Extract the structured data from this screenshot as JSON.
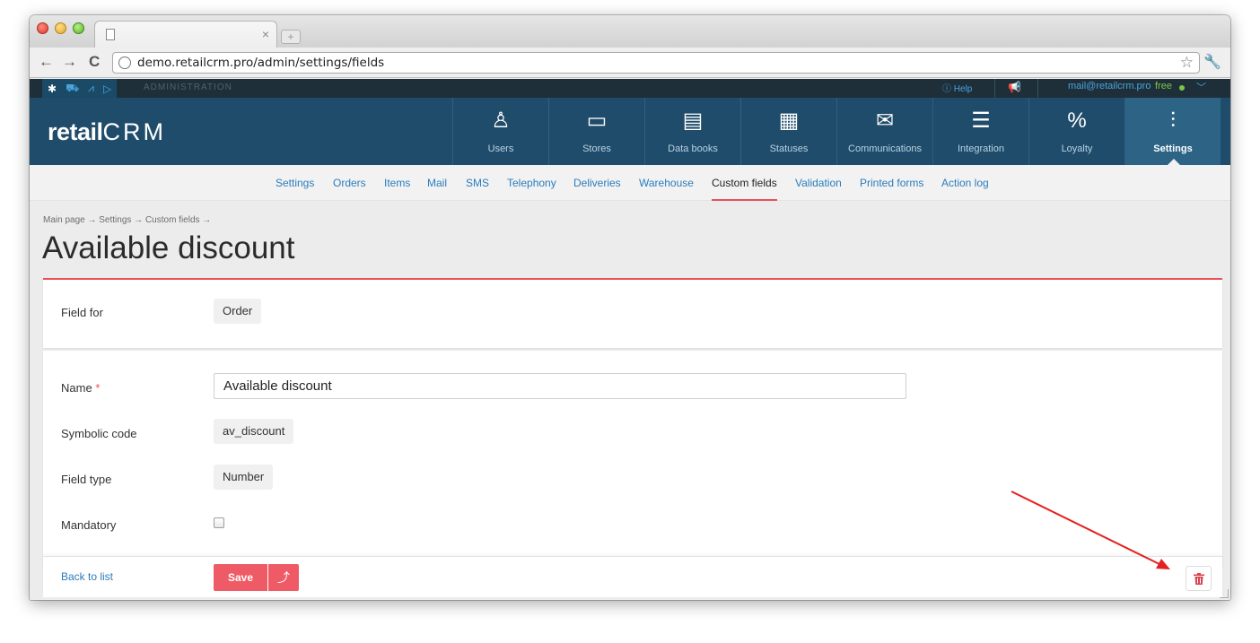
{
  "browser": {
    "url": "demo.retailcrm.pro/admin/settings/fields",
    "tab_close": "×"
  },
  "adminbar": {
    "label": "ADMINISTRATION",
    "help": "Help",
    "email": "mail@retailcrm.pro",
    "plan": "free"
  },
  "header": {
    "logo_text": "retail",
    "logo_crm": "CRM",
    "nav": [
      {
        "label": "Users",
        "icon": "user-icon"
      },
      {
        "label": "Stores",
        "icon": "store-icon"
      },
      {
        "label": "Data books",
        "icon": "book-icon"
      },
      {
        "label": "Statuses",
        "icon": "statuses-icon"
      },
      {
        "label": "Communications",
        "icon": "mail-icon"
      },
      {
        "label": "Integration",
        "icon": "integration-icon"
      },
      {
        "label": "Loyalty",
        "icon": "percent-icon"
      },
      {
        "label": "Settings",
        "icon": "sliders-icon"
      }
    ]
  },
  "submenu": [
    "Settings",
    "Orders",
    "Items",
    "Mail",
    "SMS",
    "Telephony",
    "Deliveries",
    "Warehouse",
    "Custom fields",
    "Validation",
    "Printed forms",
    "Action log"
  ],
  "breadcrumb": "Main page → Settings → Custom fields →",
  "page_title": "Available discount",
  "form": {
    "field_for_label": "Field for",
    "field_for_value": "Order",
    "name_label": "Name",
    "name_required_mark": "*",
    "name_value": "Available discount",
    "symbolic_code_label": "Symbolic code",
    "symbolic_code_value": "av_discount",
    "field_type_label": "Field type",
    "field_type_value": "Number",
    "mandatory_label": "Mandatory",
    "mandatory_checked": false
  },
  "footer": {
    "back_label": "Back to list",
    "save_label": "Save",
    "save_more_icon": "⤴"
  },
  "colors": {
    "header_bg": "#1f4c6a",
    "accent_red": "#e8515a",
    "link_blue": "#2a7cbd",
    "annotation_arrow": "#e62020"
  }
}
